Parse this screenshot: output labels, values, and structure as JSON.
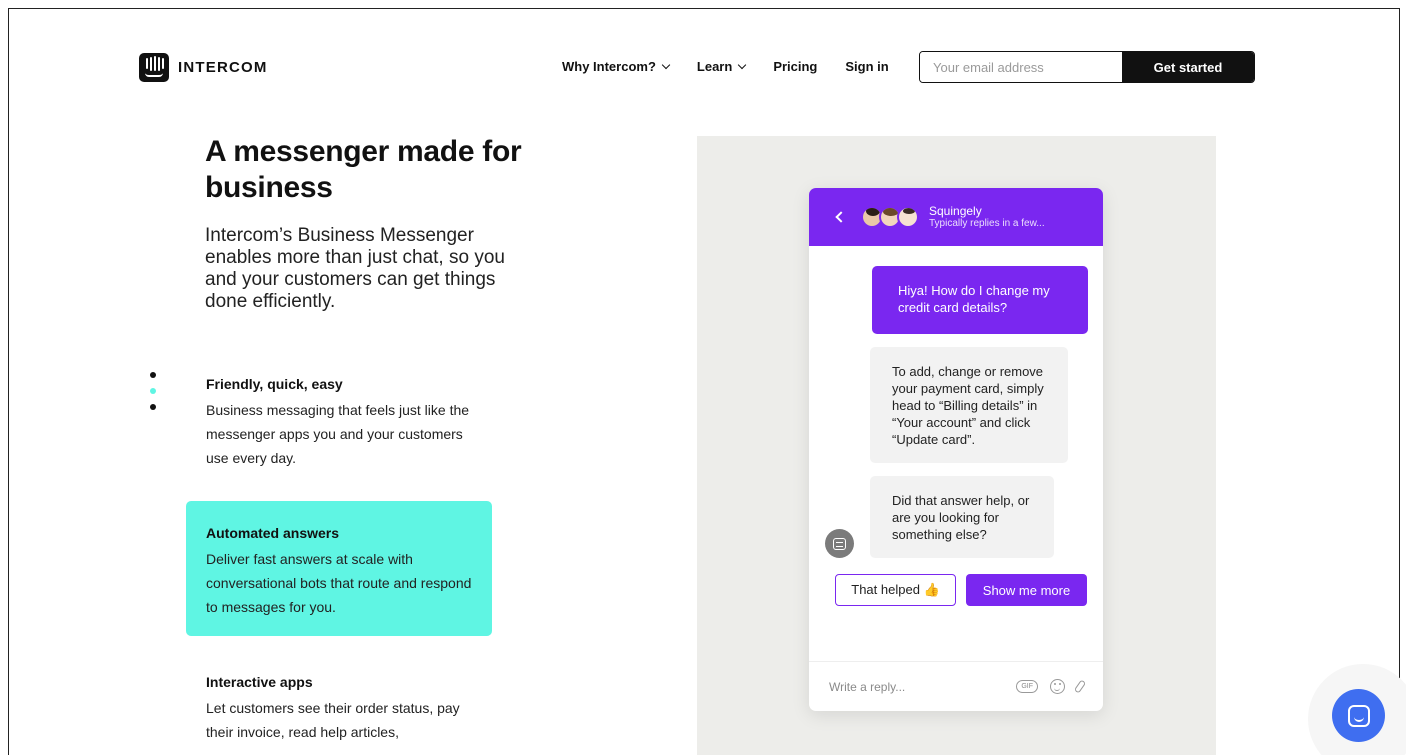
{
  "brand": {
    "name": "INTERCOM",
    "icon": "intercom-logo-icon"
  },
  "nav": {
    "items": [
      {
        "label": "Why Intercom?",
        "dropdown": true
      },
      {
        "label": "Learn",
        "dropdown": true
      },
      {
        "label": "Pricing",
        "dropdown": false
      },
      {
        "label": "Sign in",
        "dropdown": false
      }
    ],
    "email_placeholder": "Your email address",
    "cta_label": "Get started"
  },
  "hero": {
    "title": "A messenger made for business",
    "subtitle": "Intercom’s Business Messenger enables more than just chat, so you and your customers can get things done efficiently."
  },
  "features": [
    {
      "title": "Friendly, quick, easy",
      "body": "Business messaging that feels just like the messenger apps you and your customers use every day."
    },
    {
      "title": "Automated answers",
      "body": "Deliver fast answers at scale with conversational bots that route and respond to messages for you."
    },
    {
      "title": "Interactive apps",
      "body": "Let customers see their order status, pay their invoice, read help articles,"
    }
  ],
  "messenger": {
    "team_name": "Squingely",
    "status": "Typically replies in a few...",
    "user_message": "Hiya! How do I change my credit card details?",
    "bot_message_1": "To add, change or remove your payment card, simply head to “Billing details” in “Your account” and click “Update card”.",
    "bot_message_2": "Did that answer help, or are you looking for something else?",
    "quick_reply_1": "That helped 👍",
    "quick_reply_2": "Show me more",
    "reply_placeholder": "Write a reply...",
    "gif_label": "GIF"
  },
  "colors": {
    "accent_purple": "#7a27f0",
    "highlight_teal": "#5ff5e3",
    "launcher_blue": "#3f6ef0"
  }
}
